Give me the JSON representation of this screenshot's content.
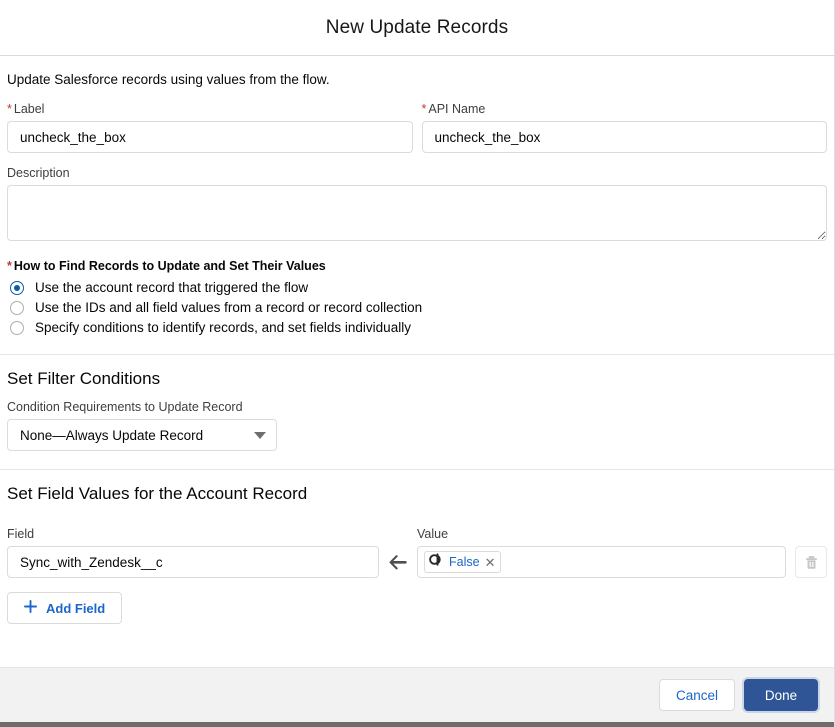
{
  "header": {
    "title": "New Update Records"
  },
  "body": {
    "intro": "Update Salesforce records using values from the flow.",
    "label_field": {
      "label": "Label",
      "required_mark": "*",
      "value": "uncheck_the_box",
      "placeholder": ""
    },
    "api_name_field": {
      "label": "API Name",
      "required_mark": "*",
      "value": "uncheck_the_box",
      "placeholder": ""
    },
    "description_field": {
      "label": "Description",
      "value": "",
      "placeholder": ""
    },
    "how_to_find": {
      "required_mark": "*",
      "legend": "How to Find Records to Update and Set Their Values",
      "options": [
        {
          "label": "Use the account record that triggered the flow",
          "selected": true
        },
        {
          "label": "Use the IDs and all field values from a record or record collection",
          "selected": false
        },
        {
          "label": "Specify conditions to identify records, and set fields individually",
          "selected": false
        }
      ]
    },
    "filter_section": {
      "heading": "Set Filter Conditions",
      "select_label": "Condition Requirements to Update Record",
      "selected_option": "None—Always Update Record",
      "caret_icon": "chevron-down-icon"
    },
    "field_values_section": {
      "heading": "Set Field Values for the Account Record",
      "field_column_label": "Field",
      "value_column_label": "Value",
      "arrow_icon": "arrow-left-icon",
      "rows": [
        {
          "field": "Sync_with_Zendesk__c",
          "value_pill": {
            "icon": "global-constant-icon",
            "text": "False",
            "remove_icon": "close-icon"
          },
          "delete_icon": "trash-icon"
        }
      ],
      "add_field_button": {
        "icon": "plus-icon",
        "label": "Add Field"
      }
    }
  },
  "footer": {
    "cancel_label": "Cancel",
    "done_label": "Done"
  },
  "colors": {
    "brand_blue": "#1b66c9",
    "done_button": "#2f5596",
    "required_red": "#c23934",
    "radio_selected": "#0b5cab",
    "border": "#dddbda",
    "footer_bg": "#f3f2f2"
  }
}
